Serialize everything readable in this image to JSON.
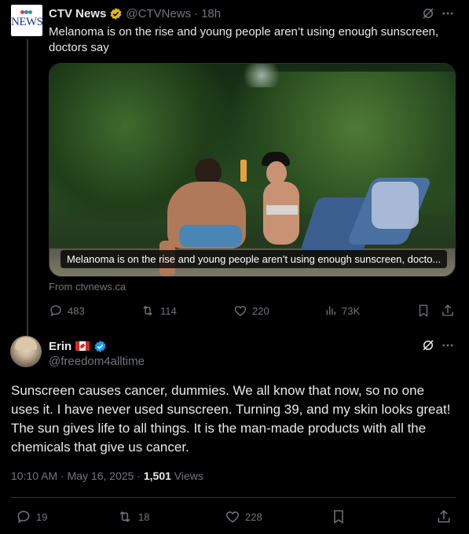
{
  "tweet1": {
    "source_logo_text": "CTV NEWS",
    "author_name": "CTV News",
    "handle": "@CTVNews",
    "separator": "·",
    "time": "18h",
    "text": "Melanoma is on the rise and young people aren’t using enough sunscreen, doctors say",
    "card_caption": "Melanoma is on the rise and young people aren’t using enough sunscreen, docto...",
    "from_label": "From ctvnews.ca",
    "stats": {
      "replies": "483",
      "retweets": "114",
      "likes": "220",
      "views": "73K"
    }
  },
  "tweet2": {
    "author_name": "Erin",
    "flag": "🇨🇦",
    "handle": "@freedom4alltime",
    "text": "Sunscreen causes cancer, dummies. We all know that now, so no one uses it. I have never used sunscreen. Turning 39, and my skin looks great! The sun gives life to all things. It is the man-made products with all the chemicals that give us cancer.",
    "timestamp": "10:10 AM · May 16, 2025 · ",
    "views_count": "1,501",
    "views_label": " Views",
    "stats": {
      "replies": "19",
      "retweets": "18",
      "likes": "228"
    }
  },
  "colors": {
    "background": "#000000",
    "muted": "#71767b",
    "verified_gold": "#e2b719",
    "verified_blue": "#1d9bf0",
    "divider": "#2f3336"
  },
  "icons": [
    "grok-icon",
    "more-icon",
    "reply-icon",
    "retweet-icon",
    "like-icon",
    "views-icon",
    "bookmark-icon",
    "share-icon",
    "verified-badge-icon"
  ]
}
